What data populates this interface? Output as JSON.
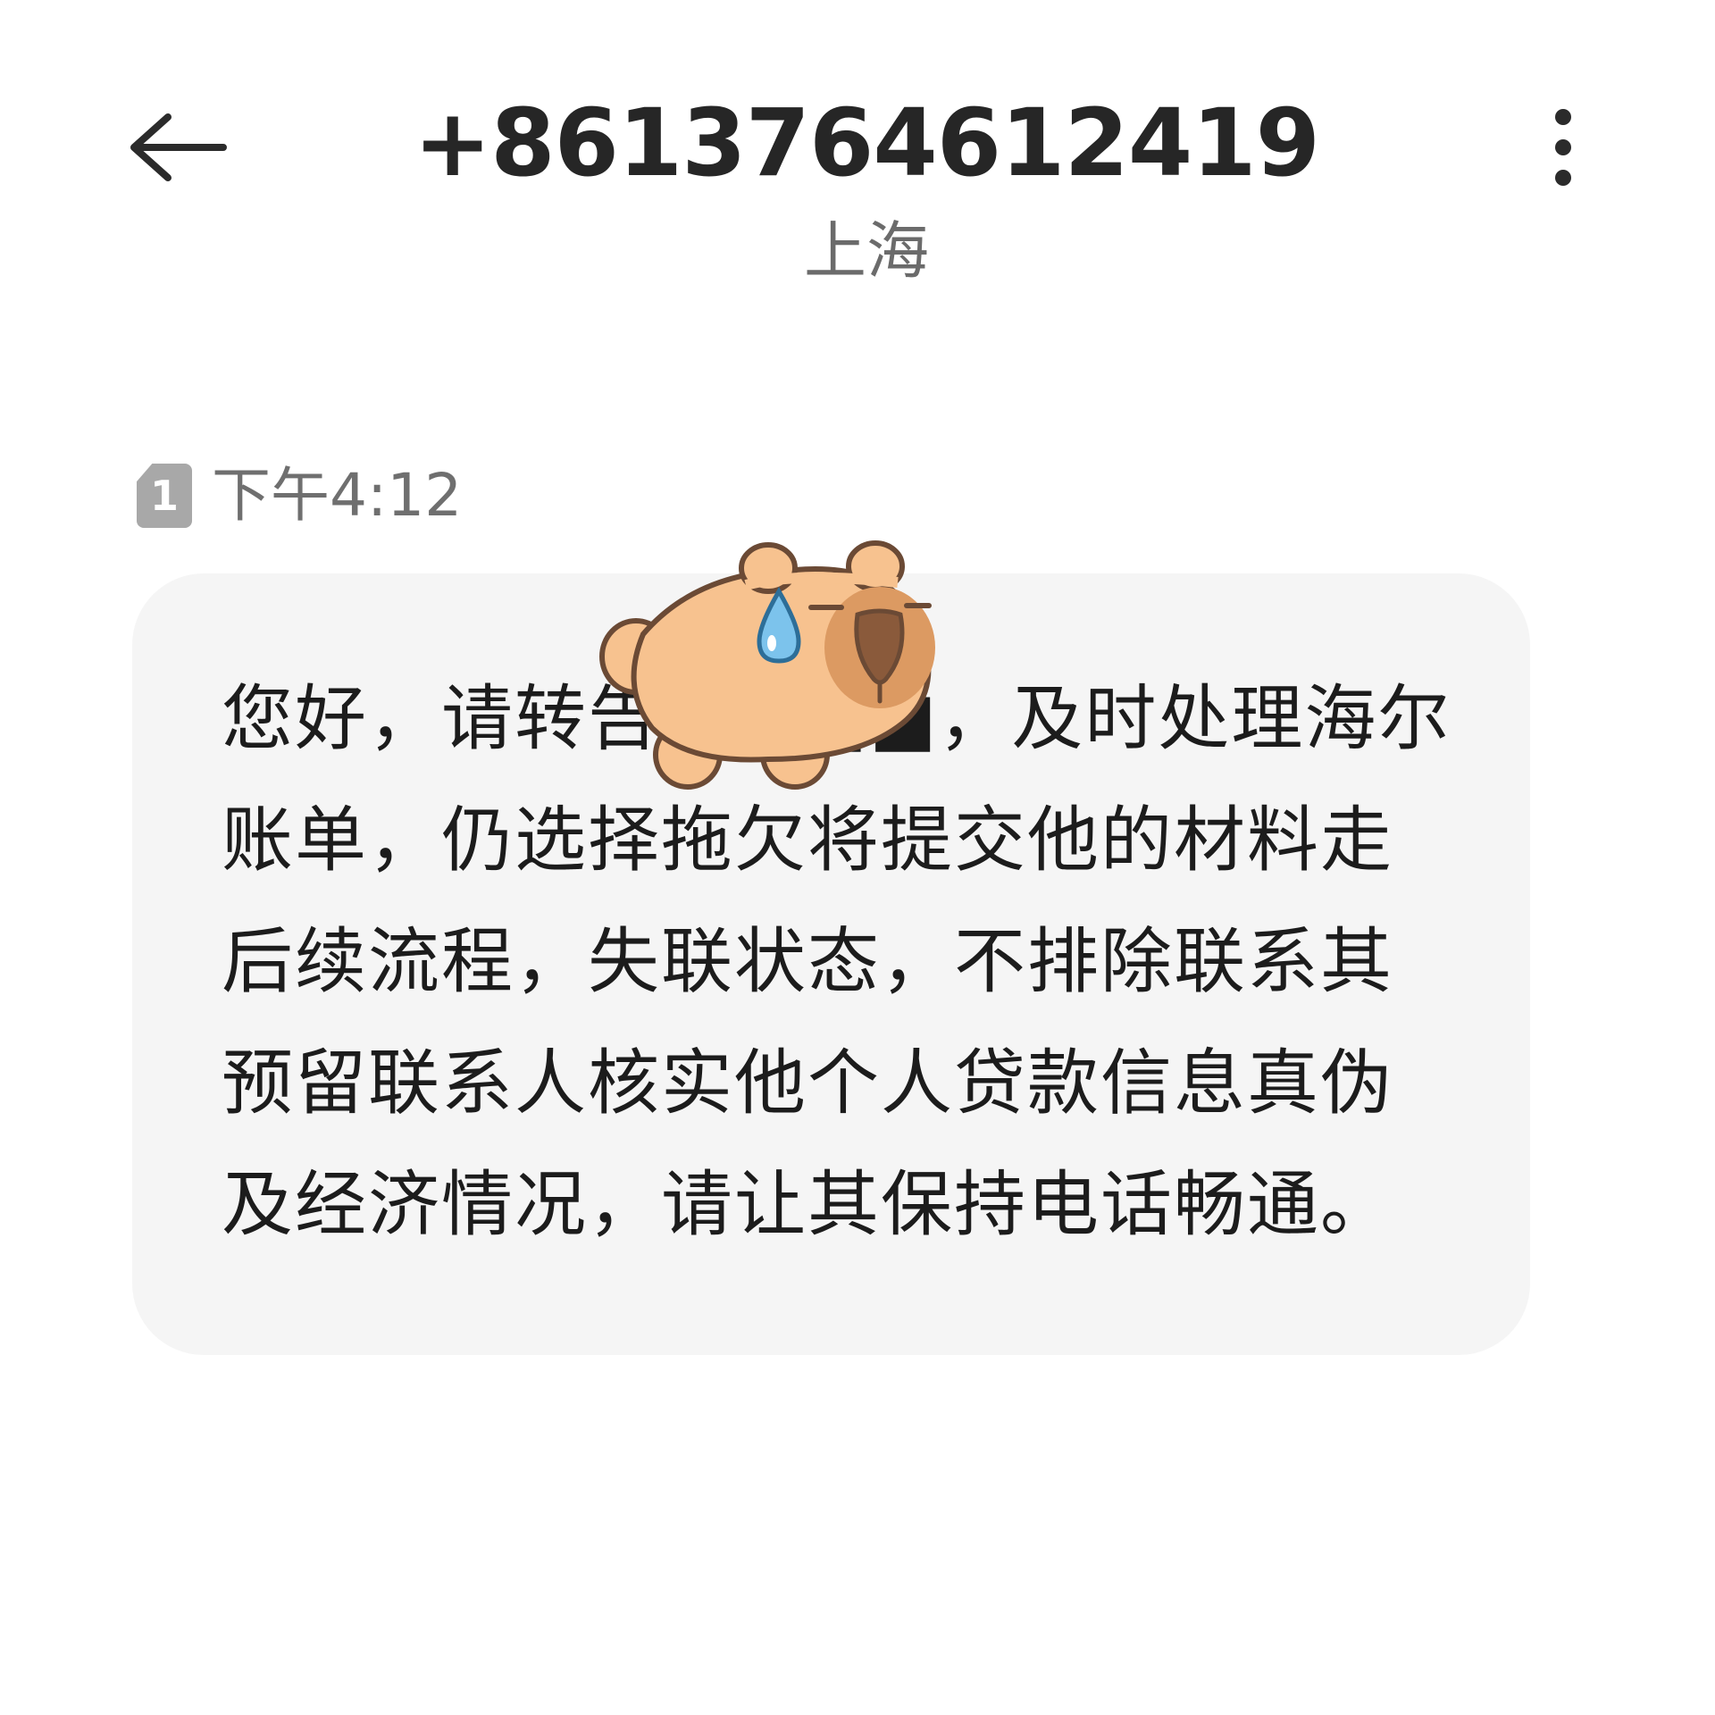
{
  "header": {
    "back_icon": "arrow-left-icon",
    "contact_number": "+8613764612419",
    "location": "上海",
    "menu_icon": "more-vertical-icon"
  },
  "message": {
    "sim_slot": "1",
    "sim_icon": "sim-card-icon",
    "time": "下午4:12",
    "body": "您好，请转告■■■■，及时处理海尔账单，仍选择拖欠将提交他的材料走后续流程，失联状态，不排除联系其预留联系人核实他个人贷款信息真伪及经济情况，请让其保持电话畅通。",
    "overlay_sticker": "capybara-sweat-sticker"
  },
  "colors": {
    "background": "#ffffff",
    "bubble": "#f5f5f5",
    "title_text": "#262626",
    "secondary_text": "#6b6b6b",
    "sticker_body": "#f7c28f",
    "sticker_outline": "#6b4a35"
  }
}
